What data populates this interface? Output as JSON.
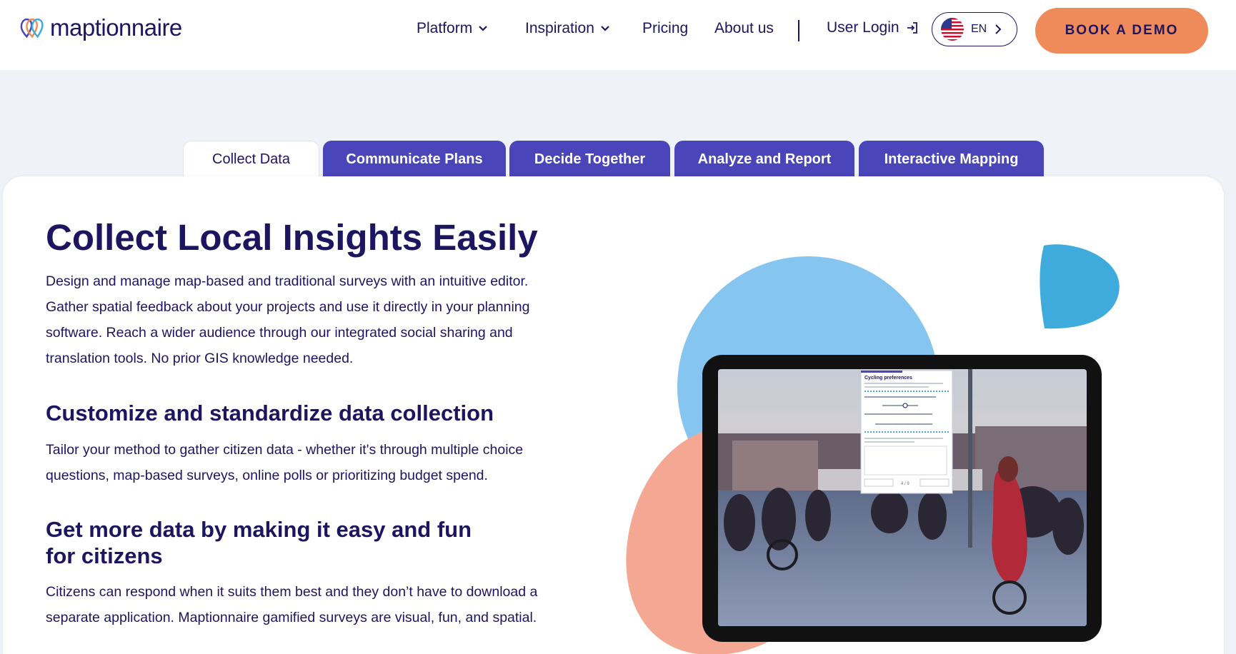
{
  "brand": {
    "name": "maptionnaire"
  },
  "nav": {
    "platform": "Platform",
    "inspiration": "Inspiration",
    "pricing": "Pricing",
    "about": "About us",
    "login": "User Login",
    "lang": "EN",
    "demo": "BOOK A DEMO"
  },
  "tabs": [
    {
      "label": "Collect Data",
      "active": true
    },
    {
      "label": "Communicate Plans",
      "active": false
    },
    {
      "label": "Decide Together",
      "active": false
    },
    {
      "label": "Analyze and Report",
      "active": false
    },
    {
      "label": "Interactive Mapping",
      "active": false
    }
  ],
  "content": {
    "title": "Collect Local Insights Easily",
    "intro": "Design and manage map-based and traditional surveys with an intuitive editor. Gather spatial feedback about your projects and use it directly in your planning software. Reach a wider audience through our integrated social sharing and translation tools. No prior GIS knowledge needed.",
    "section1_title": "Customize and standardize data collection",
    "section1_text": "Tailor your method to gather citizen data - whether it's through multiple choice questions, map-based surveys, online polls or prioritizing budget spend.",
    "section2_title": "Get more data by making it easy and fun for citizens",
    "section2_text": "Citizens can respond when it suits them best and they don’t have to download a separate application. Maptionnaire gamified surveys are visual, fun, and spatial."
  },
  "survey": {
    "title": "Cycling preferences",
    "pager": "4 / 9"
  },
  "colors": {
    "navy": "#1d1560",
    "tab_bg": "#4a45b8",
    "accent_orange": "#ef8b5b",
    "blob_blue": "#86c5f0",
    "blob_drop": "#3fabdc",
    "blob_peach": "#f4a893"
  }
}
